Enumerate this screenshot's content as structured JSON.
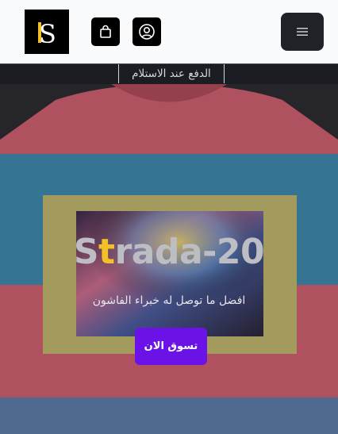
{
  "header": {
    "logo_icon": "strada-logo",
    "cart_icon": "shopping-bag-icon",
    "account_icon": "user-circle-icon",
    "menu_icon": "hamburger-menu-icon"
  },
  "announcement": {
    "text": "الدفع عند الاستلام"
  },
  "hero": {
    "title_prefix": "S",
    "title_accent": "t",
    "title_rest": "rada-20",
    "subtitle": "افضل ما توصل له خبراء الفاشون",
    "cta_label": "تسوق الان"
  },
  "colors": {
    "accent": "#f4c02a",
    "cta": "#6b12e6",
    "header_bg": "#f9fafb",
    "menu_bg": "#1f2328"
  }
}
